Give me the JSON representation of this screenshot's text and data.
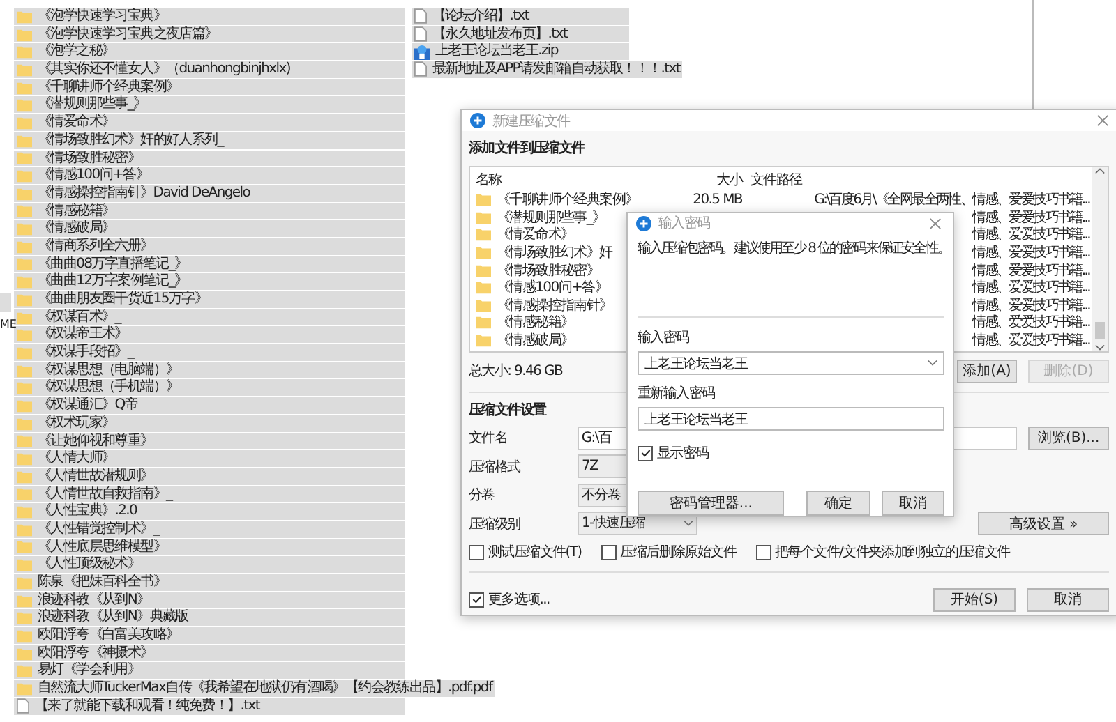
{
  "folder_list": [
    {
      "name": "《泡学快速学习宝典》",
      "kind": "folder"
    },
    {
      "name": "《泡学快速学习宝典之夜店篇》",
      "kind": "folder"
    },
    {
      "name": "《泡学之秘》",
      "kind": "folder"
    },
    {
      "name": "《其实你还不懂女人》（duanhongbinjhxlx)",
      "kind": "folder"
    },
    {
      "name": "《千聊讲师个经典案例》",
      "kind": "folder"
    },
    {
      "name": "《潜规则那些事_》",
      "kind": "folder"
    },
    {
      "name": "《情爱命术》",
      "kind": "folder"
    },
    {
      "name": "《情场致胜幻术》奸的好人系列_",
      "kind": "folder"
    },
    {
      "name": "《情场致胜秘密》",
      "kind": "folder"
    },
    {
      "name": "《情感100问+答》",
      "kind": "folder"
    },
    {
      "name": "《情感操控指南针》David DeAngelo",
      "kind": "folder"
    },
    {
      "name": "《情感秘籍》",
      "kind": "folder"
    },
    {
      "name": "《情感破局》",
      "kind": "folder"
    },
    {
      "name": "《情商系列全六册》",
      "kind": "folder"
    },
    {
      "name": "《曲曲08万字直播笔记_》",
      "kind": "folder"
    },
    {
      "name": "《曲曲12万字案例笔记_》",
      "kind": "folder"
    },
    {
      "name": "《曲曲朋友圈干货近15万字》",
      "kind": "folder"
    },
    {
      "name": "《权谋百术》_",
      "kind": "folder"
    },
    {
      "name": "《权谋帝王术》",
      "kind": "folder"
    },
    {
      "name": "《权谋手段招》_",
      "kind": "folder"
    },
    {
      "name": "《权谋思想（电脑端）》",
      "kind": "folder"
    },
    {
      "name": "《权谋思想（手机端）》",
      "kind": "folder"
    },
    {
      "name": "《权谋通汇》Q帝",
      "kind": "folder"
    },
    {
      "name": "《权术玩家》",
      "kind": "folder"
    },
    {
      "name": "《让她仰视和尊重》",
      "kind": "folder"
    },
    {
      "name": "《人情大师》",
      "kind": "folder"
    },
    {
      "name": "《人情世故潜规则》",
      "kind": "folder"
    },
    {
      "name": "《人情世故自救指南》_",
      "kind": "folder"
    },
    {
      "name": "《人性宝典》.2.0",
      "kind": "folder"
    },
    {
      "name": "《人性错觉控制术》_",
      "kind": "folder"
    },
    {
      "name": "《人性底层思维模型》",
      "kind": "folder"
    },
    {
      "name": "《人性顶级秘术》",
      "kind": "folder"
    },
    {
      "name": "陈泉《把妹百科全书》",
      "kind": "folder"
    },
    {
      "name": "浪迹科教《从到N》",
      "kind": "folder"
    },
    {
      "name": "浪迹科教《从到N》典藏版",
      "kind": "folder"
    },
    {
      "name": "欧阳浮夸《白富美攻略》",
      "kind": "folder"
    },
    {
      "name": "欧阳浮夸《神摄术》",
      "kind": "folder"
    },
    {
      "name": "易灯《学会利用》",
      "kind": "folder"
    },
    {
      "name": "自然流大师TuckerMax自传《我希望在地狱仍有酒喝》【约会教练出品】.pdf.pdf",
      "kind": "folder"
    },
    {
      "name": "【来了就能下载和观看！纯免费！】.txt",
      "kind": "file"
    }
  ],
  "side_fragment": "ME",
  "file_list": [
    {
      "name": "【论坛介绍】.txt",
      "kind": "file"
    },
    {
      "name": "【永久地址发布页】.txt",
      "kind": "file"
    },
    {
      "name": "上老王论坛当老王.zip",
      "kind": "archive"
    },
    {
      "name": "最新地址及APP请发邮箱自动获取！！！.txt",
      "kind": "file"
    }
  ],
  "archive_dialog": {
    "title": "新建压缩文件",
    "section_title": "添加文件到压缩文件",
    "table": {
      "columns": [
        "名称",
        "大小",
        "文件路径"
      ],
      "rows": [
        {
          "name": "《千聊讲师个经典案例》",
          "size": "20.5 MB",
          "path": "G:\\百度6月\\《全网最全两性、情感、爱爱技巧书籍..."
        },
        {
          "name": "《潜规则那些事_》",
          "path": "情感、爱爱技巧书籍..."
        },
        {
          "name": "《情爱命术》",
          "path": "情感、爱爱技巧书籍..."
        },
        {
          "name": "《情场致胜幻术》奸",
          "path": "情感、爱爱技巧书籍..."
        },
        {
          "name": "《情场致胜秘密》",
          "path": "情感、爱爱技巧书籍..."
        },
        {
          "name": "《情感100问+答》",
          "path": "情感、爱爱技巧书籍..."
        },
        {
          "name": "《情感操控指南针》",
          "path": "情感、爱爱技巧书籍..."
        },
        {
          "name": "《情感秘籍》",
          "path": "情感、爱爱技巧书籍..."
        },
        {
          "name": "《情感破局》",
          "path": "情感、爱爱技巧书籍..."
        }
      ]
    },
    "total_size": "总大小: 9.46 GB",
    "add_button": {
      "label": "添加(A)",
      "disabled": false
    },
    "delete_button": {
      "label": "删除(D)",
      "disabled": true
    },
    "settings_title": "压缩文件设置",
    "fields": [
      {
        "label": "文件名",
        "value": "G:\\百",
        "kind": "text"
      },
      {
        "label": "压缩格式",
        "value": "7Z",
        "kind": "plain"
      },
      {
        "label": "分卷",
        "value": "不分卷",
        "kind": "plain"
      },
      {
        "label": "压缩级别",
        "value": "1-快速压缩",
        "kind": "select"
      }
    ],
    "browse_button": "浏览(B)...",
    "advanced_button": "高级设置 »",
    "options": [
      {
        "label": "测试压缩文件(T)",
        "checked": false
      },
      {
        "label": "压缩后删除原始文件",
        "checked": false
      },
      {
        "label": "把每个文件/文件夹添加到独立的压缩文件",
        "checked": false
      }
    ],
    "more_options": {
      "label": "更多选项...",
      "checked": true
    },
    "start_button": "开始(S)",
    "cancel_button": "取消"
  },
  "password_dialog": {
    "title": "输入密码",
    "hint": "输入压缩包密码。建议使用至少 8 位的密码来保证安全性。",
    "password_label": "输入密码",
    "password_value": "上老王论坛当老王",
    "repeat_label": "重新输入密码",
    "repeat_value": "上老王论坛当老王",
    "show_password": {
      "label": "显示密码",
      "checked": true
    },
    "manager_button": "密码管理器...",
    "ok_button": "确定",
    "cancel_button": "取消"
  }
}
